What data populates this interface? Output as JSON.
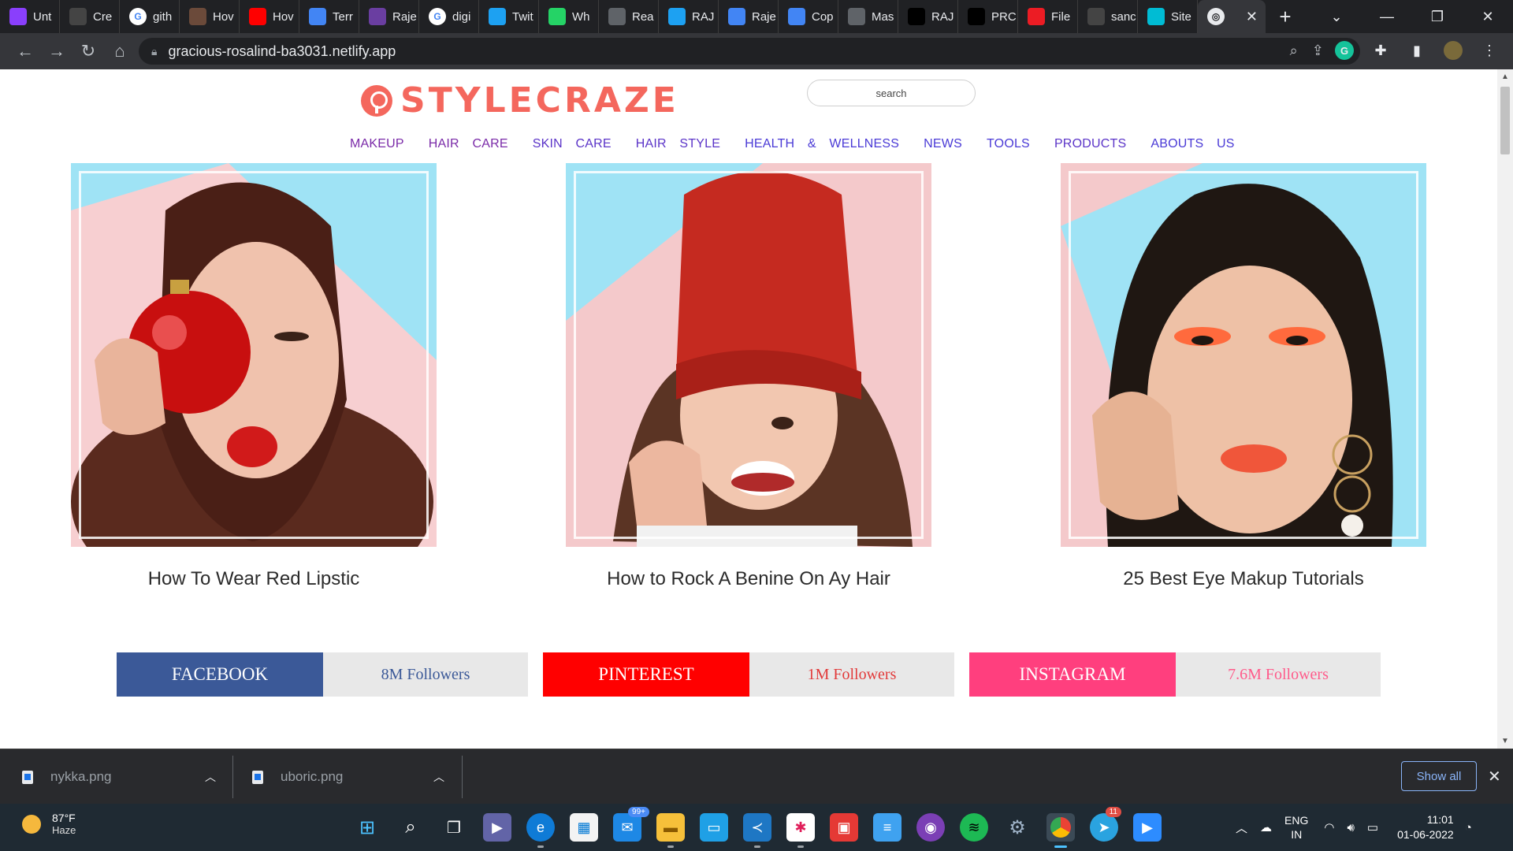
{
  "browser": {
    "tabs": [
      {
        "label": "Unt",
        "icon": "list-icon",
        "color": "#8a3ffc"
      },
      {
        "label": "Cre",
        "icon": "github-icon",
        "color": "#444444"
      },
      {
        "label": "gith",
        "icon": "google-icon",
        "color": "#ffffff"
      },
      {
        "label": "Hov",
        "icon": "avatar-icon",
        "color": "#6b4a3a"
      },
      {
        "label": "Hov",
        "icon": "youtube-icon",
        "color": "#ff0000"
      },
      {
        "label": "Terr",
        "icon": "docs-icon",
        "color": "#4285f4"
      },
      {
        "label": "Raje",
        "icon": "spiral-icon",
        "color": "#6a3ea1"
      },
      {
        "label": "digi",
        "icon": "google-icon",
        "color": "#ffffff"
      },
      {
        "label": "Twit",
        "icon": "twitter-icon",
        "color": "#1da1f2"
      },
      {
        "label": "Wh",
        "icon": "whatsapp-icon",
        "color": "#25d366"
      },
      {
        "label": "Rea",
        "icon": "globe-icon",
        "color": "#5f6368"
      },
      {
        "label": "RAJ",
        "icon": "twitter-icon",
        "color": "#1da1f2"
      },
      {
        "label": "Raje",
        "icon": "docs-icon",
        "color": "#4285f4"
      },
      {
        "label": "Cop",
        "icon": "docs-icon",
        "color": "#4285f4"
      },
      {
        "label": "Mas",
        "icon": "globe-icon",
        "color": "#5f6368"
      },
      {
        "label": "RAJ",
        "icon": "medium-icon",
        "color": "#000000"
      },
      {
        "label": "PRC",
        "icon": "medium-icon",
        "color": "#000000"
      },
      {
        "label": "File",
        "icon": "acrobat-icon",
        "color": "#ec1c24"
      },
      {
        "label": "sanc",
        "icon": "github-icon",
        "color": "#444444"
      },
      {
        "label": "Site",
        "icon": "diamond-icon",
        "color": "#00bcd4"
      }
    ],
    "active_tab_close": "✕",
    "new_tab": "+",
    "url": "gracious-rosalind-ba3031.netlify.app"
  },
  "site": {
    "logo_text": "STYLECRAZE",
    "brand_color": "#f4675d",
    "search_placeholder": "search",
    "nav": [
      {
        "label": "MAKEUP",
        "color": "#7a2aa8"
      },
      {
        "label": "HAIR CARE",
        "color": "#7a2aa8"
      },
      {
        "label": "SKIN CARE",
        "color": "#5b34c8"
      },
      {
        "label": "HAIR STYLE",
        "color": "#5b34c8"
      },
      {
        "label": "HEALTH & WELLNESS",
        "color": "#4a3ad6"
      },
      {
        "label": "NEWS",
        "color": "#4a3ad6"
      },
      {
        "label": "TOOLS",
        "color": "#4a3ad6"
      },
      {
        "label": "PRODUCTS",
        "color": "#5b34c8"
      },
      {
        "label": "ABOUTS US",
        "color": "#4a3ad6"
      }
    ],
    "cards": [
      {
        "title": "How To Wear Red Lipstic",
        "image": "woman with red ornament"
      },
      {
        "title": "How to Rock A Benine On Ay Hair",
        "image": "woman in red beanie"
      },
      {
        "title": "25 Best Eye Makup Tutorials",
        "image": "woman with orange eye makeup"
      }
    ],
    "social": [
      {
        "name": "FACEBOOK",
        "followers": "8M Followers",
        "color": "#3b5998",
        "text_color": "#3b5998"
      },
      {
        "name": "PINTEREST",
        "followers": "1M Followers",
        "color": "#ff0000",
        "text_color": "#e23a3a"
      },
      {
        "name": "INSTAGRAM",
        "followers": "7.6M Followers",
        "color": "#ff3f7e",
        "text_color": "#ff5a8a"
      }
    ]
  },
  "downloads": {
    "items": [
      {
        "name": "nykka.png"
      },
      {
        "name": "uboric.png"
      }
    ],
    "show_all": "Show all"
  },
  "taskbar": {
    "weather_temp": "87°F",
    "weather_desc": "Haze",
    "mail_badge": "99+",
    "telegram_badge": "11",
    "lang_line1": "ENG",
    "lang_line2": "IN",
    "time": "11:01",
    "date": "01-06-2022"
  }
}
